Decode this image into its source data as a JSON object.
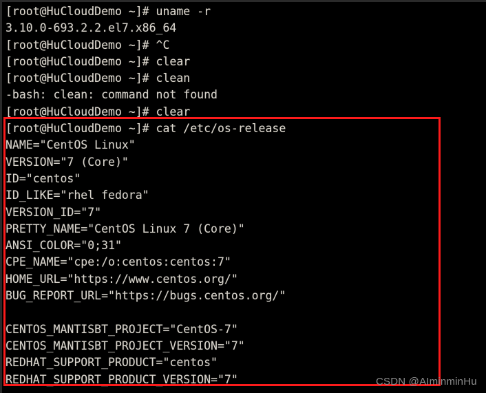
{
  "terminal": {
    "hostname": "HuCloudDemo",
    "user": "root",
    "prompt": "[root@HuCloudDemo ~]#",
    "background_color": "#000000",
    "text_color": "#d8d4cc",
    "lines": [
      {
        "id": "line-01",
        "text": "[root@HuCloudDemo ~]# uname -r",
        "kind": "prompt"
      },
      {
        "id": "line-02",
        "text": "3.10.0-693.2.2.el7.x86_64",
        "kind": "output"
      },
      {
        "id": "line-03",
        "text": "[root@HuCloudDemo ~]# ^C",
        "kind": "prompt"
      },
      {
        "id": "line-04",
        "text": "[root@HuCloudDemo ~]# clear",
        "kind": "prompt"
      },
      {
        "id": "line-05",
        "text": "[root@HuCloudDemo ~]# clean",
        "kind": "prompt"
      },
      {
        "id": "line-06",
        "text": "-bash: clean: command not found",
        "kind": "output"
      },
      {
        "id": "line-07",
        "text": "[root@HuCloudDemo ~]# clear",
        "kind": "prompt"
      },
      {
        "id": "line-08",
        "text": "[root@HuCloudDemo ~]# cat /etc/os-release",
        "kind": "prompt"
      },
      {
        "id": "line-09",
        "text": "NAME=\"CentOS Linux\"",
        "kind": "output"
      },
      {
        "id": "line-10",
        "text": "VERSION=\"7 (Core)\"",
        "kind": "output"
      },
      {
        "id": "line-11",
        "text": "ID=\"centos\"",
        "kind": "output"
      },
      {
        "id": "line-12",
        "text": "ID_LIKE=\"rhel fedora\"",
        "kind": "output"
      },
      {
        "id": "line-13",
        "text": "VERSION_ID=\"7\"",
        "kind": "output"
      },
      {
        "id": "line-14",
        "text": "PRETTY_NAME=\"CentOS Linux 7 (Core)\"",
        "kind": "output"
      },
      {
        "id": "line-15",
        "text": "ANSI_COLOR=\"0;31\"",
        "kind": "output"
      },
      {
        "id": "line-16",
        "text": "CPE_NAME=\"cpe:/o:centos:centos:7\"",
        "kind": "output"
      },
      {
        "id": "line-17",
        "text": "HOME_URL=\"https://www.centos.org/\"",
        "kind": "output"
      },
      {
        "id": "line-18",
        "text": "BUG_REPORT_URL=\"https://bugs.centos.org/\"",
        "kind": "output"
      },
      {
        "id": "line-19",
        "text": "",
        "kind": "blank"
      },
      {
        "id": "line-20",
        "text": "CENTOS_MANTISBT_PROJECT=\"CentOS-7\"",
        "kind": "output"
      },
      {
        "id": "line-21",
        "text": "CENTOS_MANTISBT_PROJECT_VERSION=\"7\"",
        "kind": "output"
      },
      {
        "id": "line-22",
        "text": "REDHAT_SUPPORT_PRODUCT=\"centos\"",
        "kind": "output"
      },
      {
        "id": "line-23",
        "text": "REDHAT_SUPPORT_PRODUCT_VERSION=\"7\"",
        "kind": "output"
      }
    ],
    "commands": [
      "uname -r",
      "clear",
      "clean",
      "cat /etc/os-release"
    ]
  },
  "annotation": {
    "type": "rectangle",
    "color": "#fb1b1b",
    "stroke_width": 3,
    "highlights_lines_from": "line-08",
    "highlights_lines_to": "line-23"
  },
  "watermark": {
    "text": "CSDN @AIminminHu",
    "color": "#8e8e8e"
  }
}
